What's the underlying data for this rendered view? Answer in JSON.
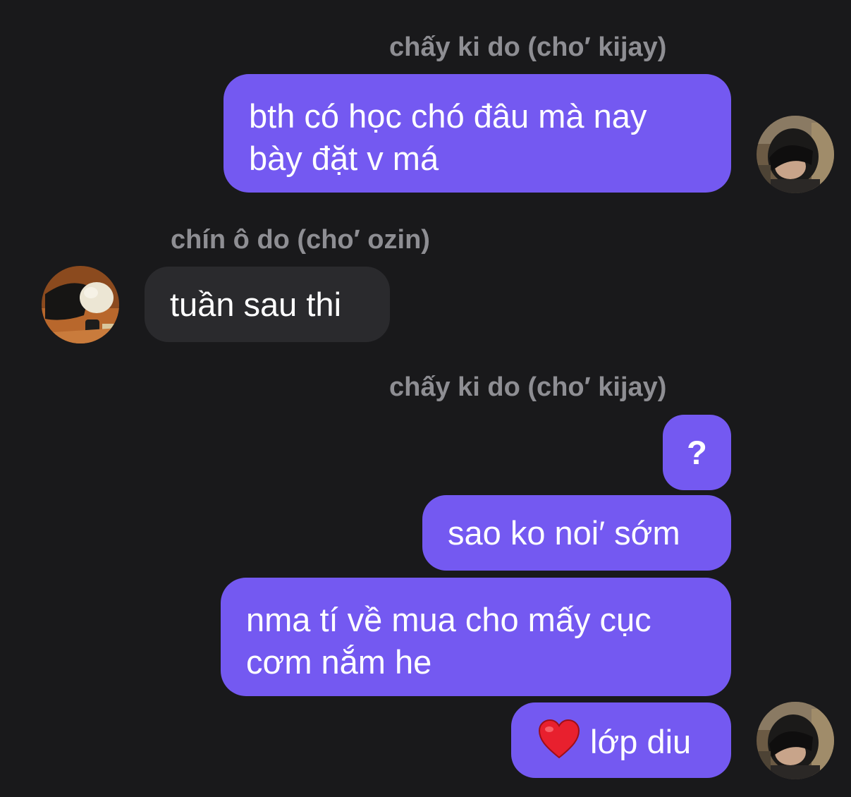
{
  "conversation": {
    "sender_1": "chấy ki do (cho′ kijay)",
    "message_1_line_1": "bth có học chó đâu mà nay",
    "message_1_line_2": "bày đặt v má",
    "sender_2": "chín ô do (cho′ ozin)",
    "message_2": "tuần sau thi",
    "sender_3": "chấy ki do (cho′ kijay)",
    "message_3": "?",
    "message_4": "sao ko noi′ sớm",
    "message_5_line_1": "nma tí về mua cho mấy cục",
    "message_5_line_2": "cơm nắm he",
    "message_6_emoji": "heart-emoji",
    "message_6_text": "lớp diu"
  },
  "colors": {
    "background": "#19191b",
    "outgoing_bubble": "#7459f1",
    "incoming_bubble": "#2a2a2d",
    "sender_name": "#8e8e93",
    "text": "#ffffff",
    "heart": "#e8202e"
  },
  "icons": {
    "outgoing_avatar": "user-photo-avatar",
    "incoming_avatar": "user-photo-avatar"
  }
}
